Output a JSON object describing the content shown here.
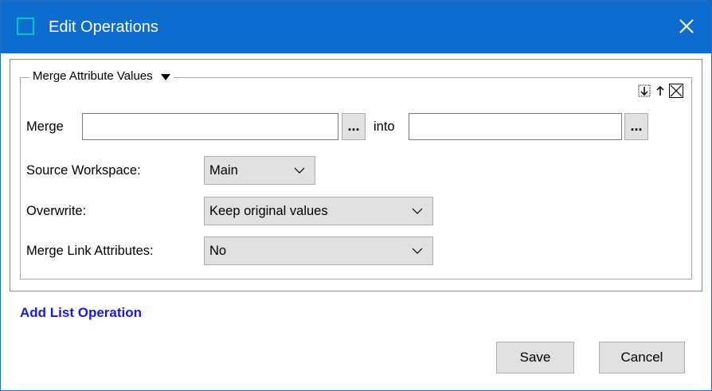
{
  "window": {
    "title": "Edit Operations"
  },
  "group": {
    "title": "Merge Attribute Values"
  },
  "merge_row": {
    "merge_label": "Merge",
    "merge_value": "",
    "dots1": "...",
    "into_label": "into",
    "into_value": "",
    "dots2": "..."
  },
  "source_workspace": {
    "label": "Source Workspace:",
    "value": "Main"
  },
  "overwrite": {
    "label": "Overwrite:",
    "value": "Keep original values"
  },
  "merge_link": {
    "label": "Merge Link Attributes:",
    "value": "No"
  },
  "add_list_operation": "Add List Operation",
  "buttons": {
    "save": "Save",
    "cancel": "Cancel"
  },
  "colors": {
    "titlebar": "#0e6ccf",
    "link": "#1a1adc",
    "button_bg": "#e1e1e1"
  }
}
